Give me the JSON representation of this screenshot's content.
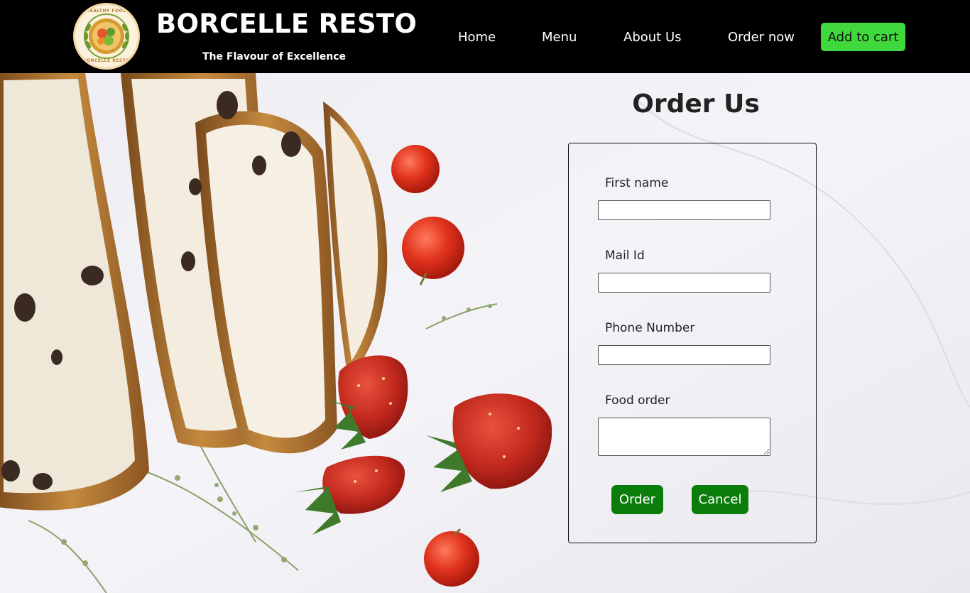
{
  "header": {
    "brand": "BORCELLE RESTO",
    "tagline": "The Flavour of Excellence",
    "logo": {
      "top_text": "HEALTHY FOOD",
      "bottom_text": "BORCELLE RESTO"
    },
    "nav": [
      "Home",
      "Menu",
      "About Us",
      "Order now"
    ],
    "cart_label": "Add to cart"
  },
  "form": {
    "title": "Order Us",
    "fields": [
      {
        "label": "First name",
        "value": "",
        "placeholder": ""
      },
      {
        "label": "Mail Id",
        "value": "",
        "placeholder": ""
      },
      {
        "label": "Phone Number",
        "value": "",
        "placeholder": ""
      },
      {
        "label": "Food order",
        "value": "",
        "placeholder": ""
      }
    ],
    "order_label": "Order",
    "cancel_label": "Cancel"
  },
  "colors": {
    "navbar": "#000000",
    "cart_button": "#40d93d",
    "action_button": "#0a7d0a",
    "background": "#f2f1f4"
  },
  "icons": [
    "healthy-food-logo"
  ]
}
